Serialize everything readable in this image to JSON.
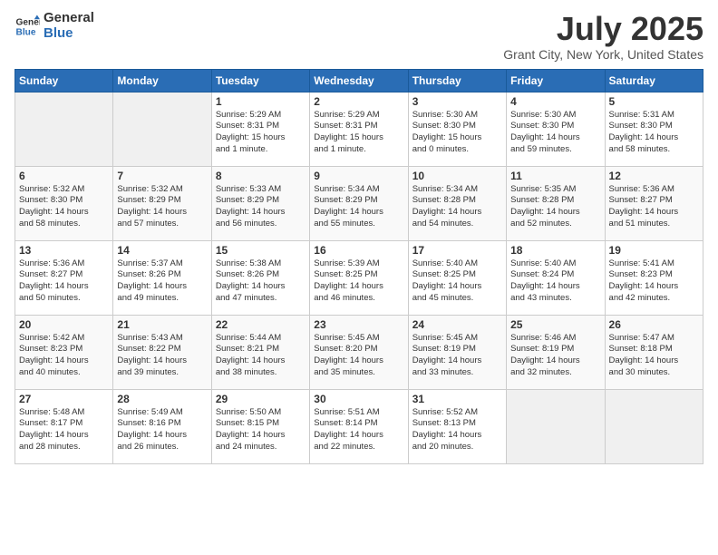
{
  "logo": {
    "general": "General",
    "blue": "Blue"
  },
  "title": "July 2025",
  "location": "Grant City, New York, United States",
  "days_of_week": [
    "Sunday",
    "Monday",
    "Tuesday",
    "Wednesday",
    "Thursday",
    "Friday",
    "Saturday"
  ],
  "weeks": [
    [
      {
        "day": "",
        "info": ""
      },
      {
        "day": "",
        "info": ""
      },
      {
        "day": "1",
        "info": "Sunrise: 5:29 AM\nSunset: 8:31 PM\nDaylight: 15 hours\nand 1 minute."
      },
      {
        "day": "2",
        "info": "Sunrise: 5:29 AM\nSunset: 8:31 PM\nDaylight: 15 hours\nand 1 minute."
      },
      {
        "day": "3",
        "info": "Sunrise: 5:30 AM\nSunset: 8:30 PM\nDaylight: 15 hours\nand 0 minutes."
      },
      {
        "day": "4",
        "info": "Sunrise: 5:30 AM\nSunset: 8:30 PM\nDaylight: 14 hours\nand 59 minutes."
      },
      {
        "day": "5",
        "info": "Sunrise: 5:31 AM\nSunset: 8:30 PM\nDaylight: 14 hours\nand 58 minutes."
      }
    ],
    [
      {
        "day": "6",
        "info": "Sunrise: 5:32 AM\nSunset: 8:30 PM\nDaylight: 14 hours\nand 58 minutes."
      },
      {
        "day": "7",
        "info": "Sunrise: 5:32 AM\nSunset: 8:29 PM\nDaylight: 14 hours\nand 57 minutes."
      },
      {
        "day": "8",
        "info": "Sunrise: 5:33 AM\nSunset: 8:29 PM\nDaylight: 14 hours\nand 56 minutes."
      },
      {
        "day": "9",
        "info": "Sunrise: 5:34 AM\nSunset: 8:29 PM\nDaylight: 14 hours\nand 55 minutes."
      },
      {
        "day": "10",
        "info": "Sunrise: 5:34 AM\nSunset: 8:28 PM\nDaylight: 14 hours\nand 54 minutes."
      },
      {
        "day": "11",
        "info": "Sunrise: 5:35 AM\nSunset: 8:28 PM\nDaylight: 14 hours\nand 52 minutes."
      },
      {
        "day": "12",
        "info": "Sunrise: 5:36 AM\nSunset: 8:27 PM\nDaylight: 14 hours\nand 51 minutes."
      }
    ],
    [
      {
        "day": "13",
        "info": "Sunrise: 5:36 AM\nSunset: 8:27 PM\nDaylight: 14 hours\nand 50 minutes."
      },
      {
        "day": "14",
        "info": "Sunrise: 5:37 AM\nSunset: 8:26 PM\nDaylight: 14 hours\nand 49 minutes."
      },
      {
        "day": "15",
        "info": "Sunrise: 5:38 AM\nSunset: 8:26 PM\nDaylight: 14 hours\nand 47 minutes."
      },
      {
        "day": "16",
        "info": "Sunrise: 5:39 AM\nSunset: 8:25 PM\nDaylight: 14 hours\nand 46 minutes."
      },
      {
        "day": "17",
        "info": "Sunrise: 5:40 AM\nSunset: 8:25 PM\nDaylight: 14 hours\nand 45 minutes."
      },
      {
        "day": "18",
        "info": "Sunrise: 5:40 AM\nSunset: 8:24 PM\nDaylight: 14 hours\nand 43 minutes."
      },
      {
        "day": "19",
        "info": "Sunrise: 5:41 AM\nSunset: 8:23 PM\nDaylight: 14 hours\nand 42 minutes."
      }
    ],
    [
      {
        "day": "20",
        "info": "Sunrise: 5:42 AM\nSunset: 8:23 PM\nDaylight: 14 hours\nand 40 minutes."
      },
      {
        "day": "21",
        "info": "Sunrise: 5:43 AM\nSunset: 8:22 PM\nDaylight: 14 hours\nand 39 minutes."
      },
      {
        "day": "22",
        "info": "Sunrise: 5:44 AM\nSunset: 8:21 PM\nDaylight: 14 hours\nand 38 minutes."
      },
      {
        "day": "23",
        "info": "Sunrise: 5:45 AM\nSunset: 8:20 PM\nDaylight: 14 hours\nand 35 minutes."
      },
      {
        "day": "24",
        "info": "Sunrise: 5:45 AM\nSunset: 8:19 PM\nDaylight: 14 hours\nand 33 minutes."
      },
      {
        "day": "25",
        "info": "Sunrise: 5:46 AM\nSunset: 8:19 PM\nDaylight: 14 hours\nand 32 minutes."
      },
      {
        "day": "26",
        "info": "Sunrise: 5:47 AM\nSunset: 8:18 PM\nDaylight: 14 hours\nand 30 minutes."
      }
    ],
    [
      {
        "day": "27",
        "info": "Sunrise: 5:48 AM\nSunset: 8:17 PM\nDaylight: 14 hours\nand 28 minutes."
      },
      {
        "day": "28",
        "info": "Sunrise: 5:49 AM\nSunset: 8:16 PM\nDaylight: 14 hours\nand 26 minutes."
      },
      {
        "day": "29",
        "info": "Sunrise: 5:50 AM\nSunset: 8:15 PM\nDaylight: 14 hours\nand 24 minutes."
      },
      {
        "day": "30",
        "info": "Sunrise: 5:51 AM\nSunset: 8:14 PM\nDaylight: 14 hours\nand 22 minutes."
      },
      {
        "day": "31",
        "info": "Sunrise: 5:52 AM\nSunset: 8:13 PM\nDaylight: 14 hours\nand 20 minutes."
      },
      {
        "day": "",
        "info": ""
      },
      {
        "day": "",
        "info": ""
      }
    ]
  ]
}
